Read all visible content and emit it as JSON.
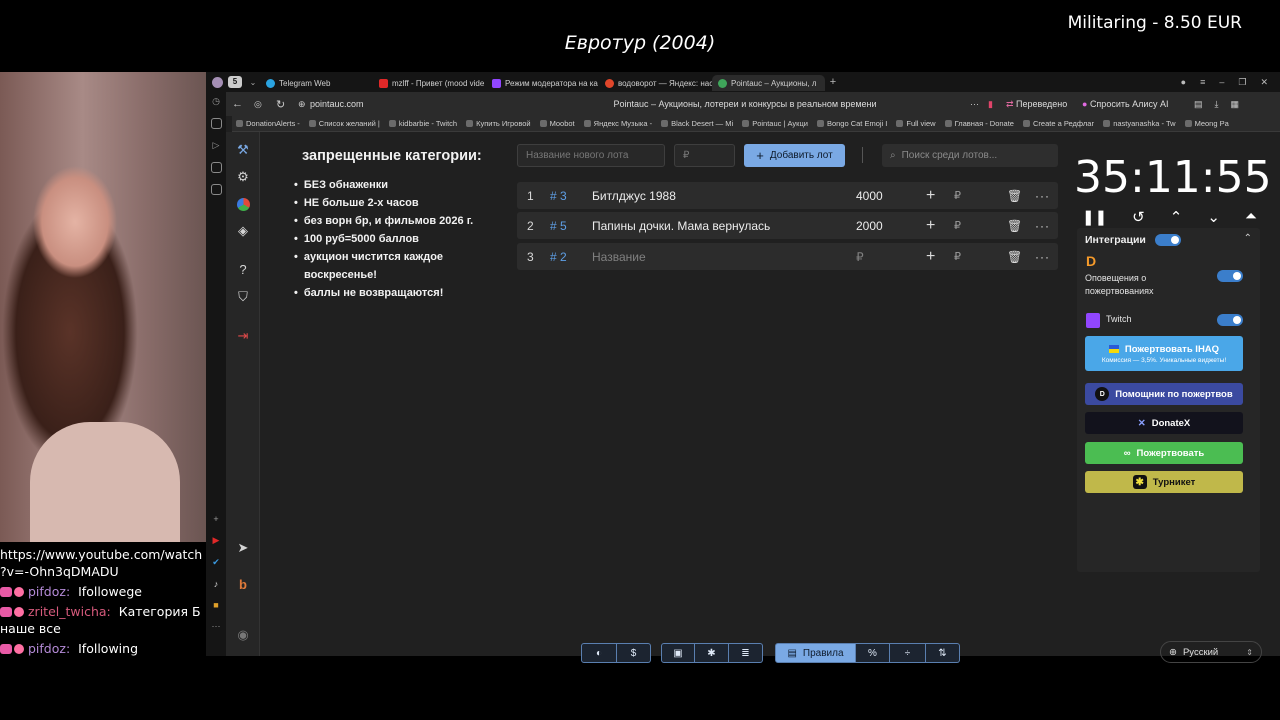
{
  "overlay": {
    "title": "Евротур (2004)",
    "donation": "Militaring - 8.50 EUR"
  },
  "chat": {
    "link_line1": "https://www.youtube.com/watch",
    "link_line2": "?v=-Ohn3qDMADU",
    "messages": [
      {
        "user": "pifdoz:",
        "text": "Ifollowege"
      },
      {
        "user": "zritel_twicha:",
        "text": "Категория Б наше все"
      },
      {
        "user": "pifdoz:",
        "text": "Ifollowing"
      }
    ]
  },
  "browser": {
    "tabs": [
      {
        "label": "Telegram Web",
        "color": "#2aa3e0"
      },
      {
        "label": "mzlff - Привет (mood vide",
        "color": "#e02828"
      },
      {
        "label": "Режим модератора на ка",
        "color": "#9146ff"
      },
      {
        "label": "водоворот — Яндекс: нас",
        "color": "#e0462a"
      },
      {
        "label": "Pointauc – Аукционы, л",
        "color": "#3fa55a"
      }
    ],
    "workspace_label": "5",
    "url": "pointauc.com",
    "page_title": "Pointauc – Аукционы, лотереи и конкурсы в реальном времени",
    "translated": "Переведено",
    "ask_alice": "Спросить Алису AI",
    "bookmarks": [
      "DonationAlerts -",
      "Список желаний |",
      "kidbarbie - Twitch",
      "Купить Игровой",
      "Moobot",
      "Яндекс Музыка -",
      "Black Desert — Mi",
      "Pointauc | Аукци",
      "Bongo Cat Emoji I",
      "Full view",
      "Главная - Donate",
      "Create a Редфлаг",
      "nastyanashka - Tw",
      "Meong Pa"
    ]
  },
  "rules": {
    "title": "запрещенные категории:",
    "items": [
      "БЕЗ обнаженки",
      "НЕ больше 2-х часов",
      "без ворн бр, и фильмов 2026 г.",
      "100 руб=5000 баллов",
      "аукцион чистится каждое воскресенье!",
      "баллы не возвращаются!"
    ]
  },
  "form": {
    "name_placeholder": "Название нового лота",
    "amount_placeholder": "₽",
    "add_label": "Добавить лот",
    "search_placeholder": "Поиск среди лотов..."
  },
  "lots": [
    {
      "num": "1",
      "id": "# 3",
      "name": "Битлджус 1988",
      "amount": "4000",
      "currency": "₽"
    },
    {
      "num": "2",
      "id": "# 5",
      "name": "Папины дочки. Мама вернулась",
      "amount": "2000",
      "currency": "₽"
    },
    {
      "num": "3",
      "id": "# 2",
      "name": "Название",
      "amount": "₽",
      "currency": "₽"
    }
  ],
  "timer": {
    "value": "35:11:55"
  },
  "integrations": {
    "title": "Интеграции",
    "donation_alerts_label": "Оповещения о пожертвованиях",
    "twitch_label": "Twitch",
    "donate_ihaq": "Пожертвовать IHAQ",
    "donate_ihaq_sub": "Комиссия — 3,5%. Уникальные виджеты!",
    "helper": "Помощник по пожертвов",
    "donatex": "DonateX",
    "donate": "Пожертвовать",
    "turnstile": "Турникет",
    "colors": {
      "ihaq": "#4aa7e8",
      "helper": "#3b4aa0",
      "donatex": "#12121c",
      "donate": "#4bbd52",
      "turnstile": "#c0b84a"
    }
  },
  "bottom": {
    "rules_label": "Правила",
    "language": "Русский"
  }
}
